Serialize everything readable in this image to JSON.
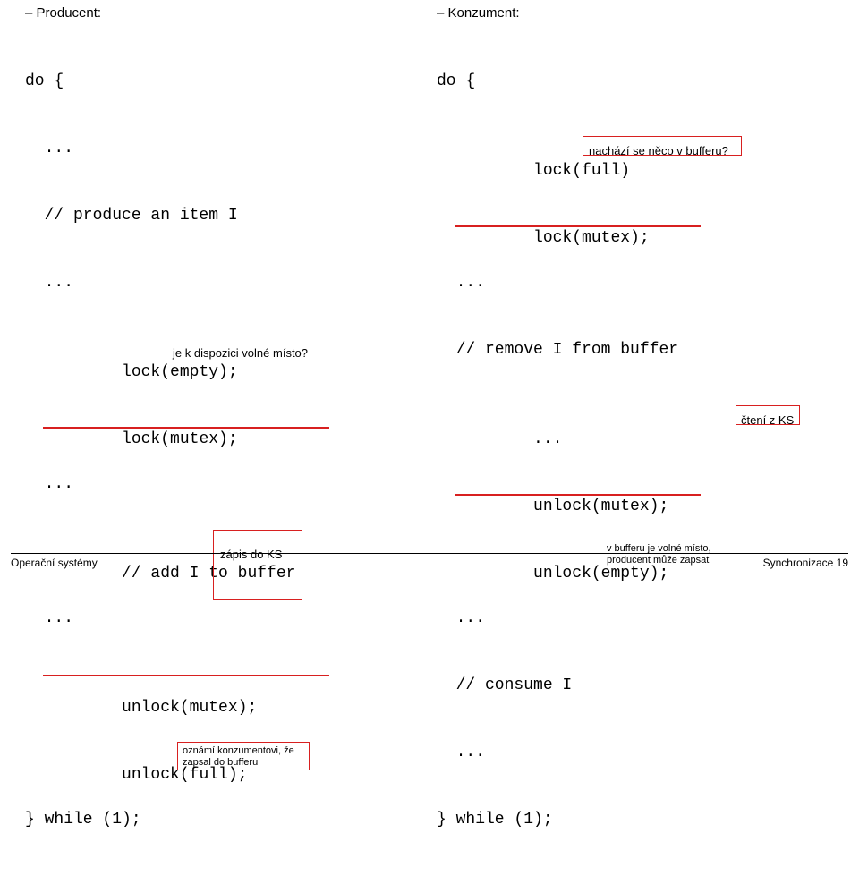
{
  "left": {
    "heading": "– Producent:",
    "c1": "do {",
    "c2": "  ...",
    "c3": "  // produce an item I",
    "c4": "  ...",
    "c5a": "  lock(empty);",
    "c5note": "je k dispozici volné místo?",
    "c6": "  lock(mutex);",
    "c7": "  ...",
    "c8a": "  // add I to buffer",
    "c8note": "zápis do KS",
    "c9": "  ...",
    "c10": "  unlock(mutex);",
    "c11a": "  unlock(full);",
    "c11note": "oznámí konzumentovi, že",
    "c11note2": "zapsal do bufferu",
    "c12": "} while (1);"
  },
  "right": {
    "heading": "– Konzument:",
    "c1": "do {",
    "c2a": "  lock(full)",
    "c2note": "nachází se něco v bufferu?",
    "c3": "  lock(mutex);",
    "c4": "  ...",
    "c5": "  // remove I from buffer",
    "c6": "  ...",
    "c6note": "čtení z KS",
    "c7": "  unlock(mutex);",
    "c8a": "  unlock(empty);",
    "c8note1": "v bufferu je volné místo,",
    "c8note2": "producent může zapsat",
    "c9": "  ...",
    "c10": "  // consume I",
    "c11": "  ...",
    "c12": "} while (1);"
  },
  "footer": {
    "left": "Operační systémy",
    "right": "Synchronizace  19"
  }
}
